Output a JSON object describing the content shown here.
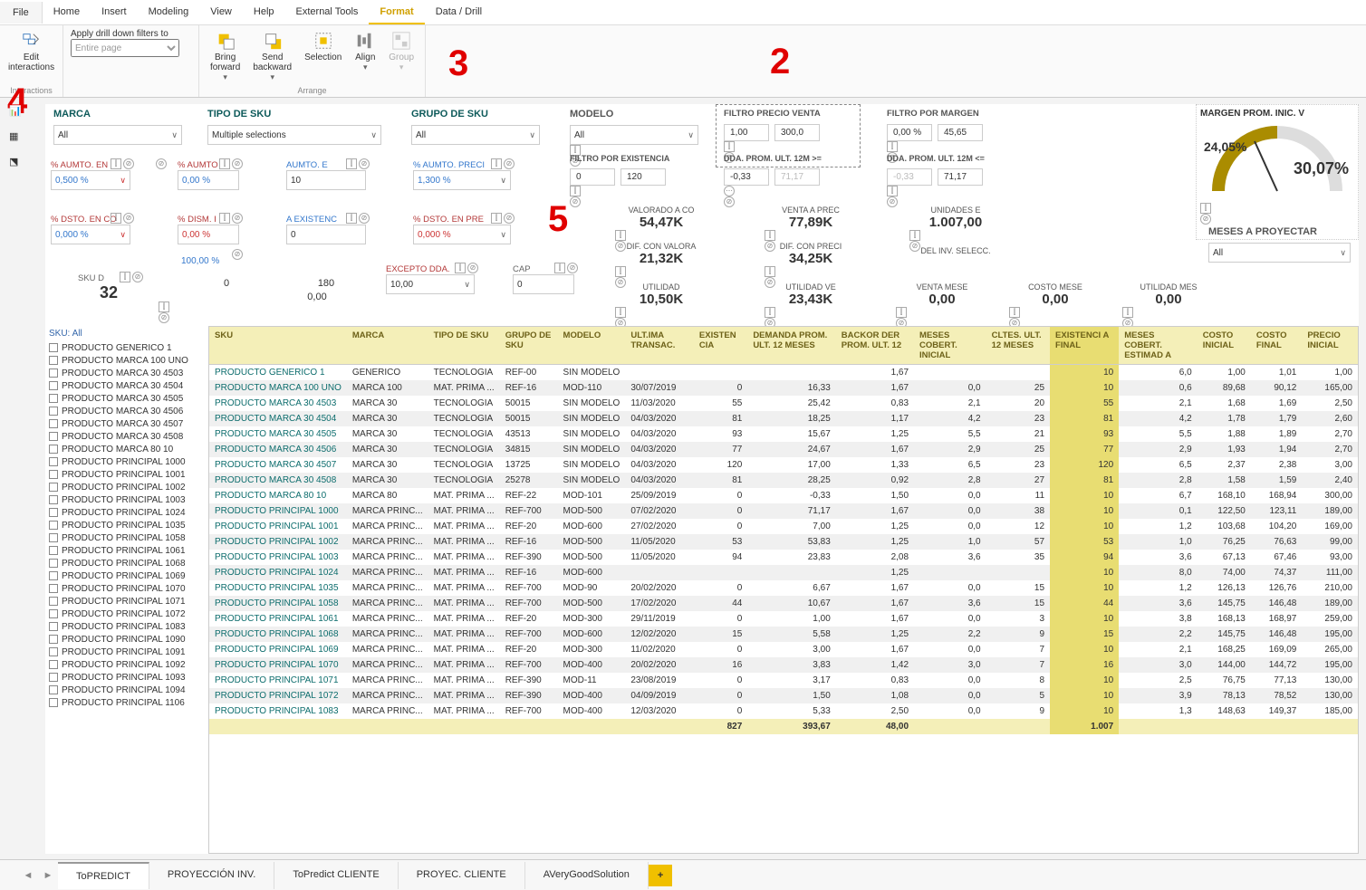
{
  "menu": {
    "file": "File",
    "items": [
      "Home",
      "Insert",
      "Modeling",
      "View",
      "Help",
      "External Tools",
      "Format",
      "Data / Drill"
    ],
    "active": 6
  },
  "ribbon": {
    "editInteractions": "Edit\ninteractions",
    "interactionsGroup": "Interactions",
    "drillLabel": "Apply drill down filters to",
    "drillPlaceholder": "Entire page",
    "bring": "Bring\nforward",
    "send": "Send\nbackward",
    "selection": "Selection",
    "align": "Align",
    "group": "Group",
    "arrangeGroup": "Arrange"
  },
  "annotations": {
    "a2": "2",
    "a3": "3",
    "a4": "4",
    "a5": "5"
  },
  "slicers": {
    "marca": {
      "title": "MARCA",
      "value": "All"
    },
    "tiposku": {
      "title": "TIPO DE SKU",
      "value": "Multiple selections"
    },
    "gruposku": {
      "title": "GRUPO DE SKU",
      "value": "All"
    },
    "modelo": {
      "title": "MODELO",
      "value": "All"
    }
  },
  "filters": {
    "precioVenta": {
      "title": "FILTRO PRECIO VENTA",
      "from": "1,00",
      "to": "300,0"
    },
    "margen": {
      "title": "FILTRO POR MARGEN",
      "from": "0,00 %",
      "to": "45,65"
    },
    "existencias": {
      "title": "FILTRO POR EXISTENCIA",
      "from": "0",
      "to": "120"
    },
    "dda12a": {
      "title": "DDA. PROM. ULT. 12M >=",
      "from": "-0,33",
      "to": "71,17"
    },
    "dda12b": {
      "title": "DDA. PROM. ULT. 12M <=",
      "from": "-0,33",
      "to": "71,17"
    }
  },
  "params": {
    "aumtoEn": {
      "label": "% AUMTO. EN",
      "value": "0,500 %"
    },
    "aumto": {
      "label": "% AUMTO",
      "value": "0,00 %"
    },
    "aumtoE": {
      "label": "AUMTO. E",
      "value": "10"
    },
    "aumtoPreci": {
      "label": "% AUMTO. PRECI",
      "value": "1,300 %"
    },
    "dstoEnC": {
      "label": "% DSTO. EN CO",
      "value": "0,000 %"
    },
    "dismI": {
      "label": "% DISM. I",
      "value": "0,00 %"
    },
    "aExisten": {
      "label": "A EXISTENC",
      "value": "0"
    },
    "dstoEnPre": {
      "label": "% DSTO. EN PRE",
      "value": "0,000 %"
    },
    "n100": {
      "label": "",
      "value": "100,00 %"
    },
    "n0": {
      "value": "0"
    },
    "n180": {
      "value": "180"
    },
    "exceptoDda": {
      "label": "EXCEPTO DDA.",
      "value": "10,00"
    },
    "cap": {
      "label": "CAP",
      "value": "0"
    },
    "skuD": {
      "label": "SKU D",
      "value": "32"
    },
    "z000": {
      "value": "0,00"
    }
  },
  "kpis": {
    "valoradoCosto": {
      "label": "VALORADO A CO",
      "value": "54,47K"
    },
    "ventaPrecio": {
      "label": "VENTA A PREC",
      "value": "77,89K"
    },
    "unidadesE": {
      "label": "UNIDADES E",
      "value": "1.007,00"
    },
    "difValor": {
      "label": "DIF. CON VALORA",
      "value": "21,32K"
    },
    "difPrecio": {
      "label": "DIF. CON PRECI",
      "value": "34,25K"
    },
    "delInv": {
      "label": "DEL INV. SELECC.",
      "value": ""
    },
    "utilidad": {
      "label": "UTILIDAD",
      "value": "10,50K"
    },
    "utilidadVe": {
      "label": "UTILIDAD VE",
      "value": "23,43K"
    },
    "ventaMese": {
      "label": "VENTA MESE",
      "value": "0,00"
    },
    "costoMese": {
      "label": "COSTO MESE",
      "value": "0,00"
    },
    "utilidadMes": {
      "label": "UTILIDAD MES",
      "value": "0,00"
    }
  },
  "gauge": {
    "title": "MARGEN PROM. INIC. V",
    "start": "24,05%",
    "end": "30,07%"
  },
  "meses": {
    "title": "MESES A PROYECTAR",
    "value": "All"
  },
  "skuAll": "SKU: All",
  "skuItems": [
    "PRODUCTO GENERICO 1",
    "PRODUCTO MARCA 100 UNO",
    "PRODUCTO MARCA 30 4503",
    "PRODUCTO MARCA 30 4504",
    "PRODUCTO MARCA 30 4505",
    "PRODUCTO MARCA 30 4506",
    "PRODUCTO MARCA 30 4507",
    "PRODUCTO MARCA 30 4508",
    "PRODUCTO MARCA 80 10",
    "PRODUCTO PRINCIPAL 1000",
    "PRODUCTO PRINCIPAL 1001",
    "PRODUCTO PRINCIPAL 1002",
    "PRODUCTO PRINCIPAL 1003",
    "PRODUCTO PRINCIPAL 1024",
    "PRODUCTO PRINCIPAL 1035",
    "PRODUCTO PRINCIPAL 1058",
    "PRODUCTO PRINCIPAL 1061",
    "PRODUCTO PRINCIPAL 1068",
    "PRODUCTO PRINCIPAL 1069",
    "PRODUCTO PRINCIPAL 1070",
    "PRODUCTO PRINCIPAL 1071",
    "PRODUCTO PRINCIPAL 1072",
    "PRODUCTO PRINCIPAL 1083",
    "PRODUCTO PRINCIPAL 1090",
    "PRODUCTO PRINCIPAL 1091",
    "PRODUCTO PRINCIPAL 1092",
    "PRODUCTO PRINCIPAL 1093",
    "PRODUCTO PRINCIPAL 1094",
    "PRODUCTO PRINCIPAL 1106"
  ],
  "table": {
    "headers": [
      "SKU",
      "MARCA",
      "TIPO DE SKU",
      "GRUPO DE SKU",
      "MODELO",
      "ULT.IMA TRANSAC.",
      "EXISTEN CIA",
      "DEMANDA PROM. ULT. 12 MESES",
      "BACKOR DER PROM. ULT. 12",
      "MESES COBERT. INICIAL",
      "CLTES. ULT. 12 MESES",
      "EXISTENCI A FINAL",
      "MESES COBERT. ESTIMAD A",
      "COSTO INICIAL",
      "COSTO FINAL",
      "PRECIO INICIAL"
    ],
    "rows": [
      [
        "PRODUCTO GENERICO 1",
        "GENERICO",
        "TECNOLOGIA",
        "REF-00",
        "SIN MODELO",
        "",
        "",
        "",
        "1,67",
        "",
        "",
        "10",
        "6,0",
        "1,00",
        "1,01",
        "1,00"
      ],
      [
        "PRODUCTO MARCA 100 UNO",
        "MARCA 100",
        "MAT. PRIMA ...",
        "REF-16",
        "MOD-110",
        "30/07/2019",
        "0",
        "16,33",
        "1,67",
        "0,0",
        "25",
        "10",
        "0,6",
        "89,68",
        "90,12",
        "165,00"
      ],
      [
        "PRODUCTO MARCA 30 4503",
        "MARCA 30",
        "TECNOLOGIA",
        "50015",
        "SIN MODELO",
        "11/03/2020",
        "55",
        "25,42",
        "0,83",
        "2,1",
        "20",
        "55",
        "2,1",
        "1,68",
        "1,69",
        "2,50"
      ],
      [
        "PRODUCTO MARCA 30 4504",
        "MARCA 30",
        "TECNOLOGIA",
        "50015",
        "SIN MODELO",
        "04/03/2020",
        "81",
        "18,25",
        "1,17",
        "4,2",
        "23",
        "81",
        "4,2",
        "1,78",
        "1,79",
        "2,60"
      ],
      [
        "PRODUCTO MARCA 30 4505",
        "MARCA 30",
        "TECNOLOGIA",
        "43513",
        "SIN MODELO",
        "04/03/2020",
        "93",
        "15,67",
        "1,25",
        "5,5",
        "21",
        "93",
        "5,5",
        "1,88",
        "1,89",
        "2,70"
      ],
      [
        "PRODUCTO MARCA 30 4506",
        "MARCA 30",
        "TECNOLOGIA",
        "34815",
        "SIN MODELO",
        "04/03/2020",
        "77",
        "24,67",
        "1,67",
        "2,9",
        "25",
        "77",
        "2,9",
        "1,93",
        "1,94",
        "2,70"
      ],
      [
        "PRODUCTO MARCA 30 4507",
        "MARCA 30",
        "TECNOLOGIA",
        "13725",
        "SIN MODELO",
        "04/03/2020",
        "120",
        "17,00",
        "1,33",
        "6,5",
        "23",
        "120",
        "6,5",
        "2,37",
        "2,38",
        "3,00"
      ],
      [
        "PRODUCTO MARCA 30 4508",
        "MARCA 30",
        "TECNOLOGIA",
        "25278",
        "SIN MODELO",
        "04/03/2020",
        "81",
        "28,25",
        "0,92",
        "2,8",
        "27",
        "81",
        "2,8",
        "1,58",
        "1,59",
        "2,40"
      ],
      [
        "PRODUCTO MARCA 80 10",
        "MARCA 80",
        "MAT. PRIMA ...",
        "REF-22",
        "MOD-101",
        "25/09/2019",
        "0",
        "-0,33",
        "1,50",
        "0,0",
        "11",
        "10",
        "6,7",
        "168,10",
        "168,94",
        "300,00"
      ],
      [
        "PRODUCTO PRINCIPAL 1000",
        "MARCA PRINC...",
        "MAT. PRIMA ...",
        "REF-700",
        "MOD-500",
        "07/02/2020",
        "0",
        "71,17",
        "1,67",
        "0,0",
        "38",
        "10",
        "0,1",
        "122,50",
        "123,11",
        "189,00"
      ],
      [
        "PRODUCTO PRINCIPAL 1001",
        "MARCA PRINC...",
        "MAT. PRIMA ...",
        "REF-20",
        "MOD-600",
        "27/02/2020",
        "0",
        "7,00",
        "1,25",
        "0,0",
        "12",
        "10",
        "1,2",
        "103,68",
        "104,20",
        "169,00"
      ],
      [
        "PRODUCTO PRINCIPAL 1002",
        "MARCA PRINC...",
        "MAT. PRIMA ...",
        "REF-16",
        "MOD-500",
        "11/05/2020",
        "53",
        "53,83",
        "1,25",
        "1,0",
        "57",
        "53",
        "1,0",
        "76,25",
        "76,63",
        "99,00"
      ],
      [
        "PRODUCTO PRINCIPAL 1003",
        "MARCA PRINC...",
        "MAT. PRIMA ...",
        "REF-390",
        "MOD-500",
        "11/05/2020",
        "94",
        "23,83",
        "2,08",
        "3,6",
        "35",
        "94",
        "3,6",
        "67,13",
        "67,46",
        "93,00"
      ],
      [
        "PRODUCTO PRINCIPAL 1024",
        "MARCA PRINC...",
        "MAT. PRIMA ...",
        "REF-16",
        "MOD-600",
        "",
        "",
        "",
        "1,25",
        "",
        "",
        "10",
        "8,0",
        "74,00",
        "74,37",
        "111,00"
      ],
      [
        "PRODUCTO PRINCIPAL 1035",
        "MARCA PRINC...",
        "MAT. PRIMA ...",
        "REF-700",
        "MOD-90",
        "20/02/2020",
        "0",
        "6,67",
        "1,67",
        "0,0",
        "15",
        "10",
        "1,2",
        "126,13",
        "126,76",
        "210,00"
      ],
      [
        "PRODUCTO PRINCIPAL 1058",
        "MARCA PRINC...",
        "MAT. PRIMA ...",
        "REF-700",
        "MOD-500",
        "17/02/2020",
        "44",
        "10,67",
        "1,67",
        "3,6",
        "15",
        "44",
        "3,6",
        "145,75",
        "146,48",
        "189,00"
      ],
      [
        "PRODUCTO PRINCIPAL 1061",
        "MARCA PRINC...",
        "MAT. PRIMA ...",
        "REF-20",
        "MOD-300",
        "29/11/2019",
        "0",
        "1,00",
        "1,67",
        "0,0",
        "3",
        "10",
        "3,8",
        "168,13",
        "168,97",
        "259,00"
      ],
      [
        "PRODUCTO PRINCIPAL 1068",
        "MARCA PRINC...",
        "MAT. PRIMA ...",
        "REF-700",
        "MOD-600",
        "12/02/2020",
        "15",
        "5,58",
        "1,25",
        "2,2",
        "9",
        "15",
        "2,2",
        "145,75",
        "146,48",
        "195,00"
      ],
      [
        "PRODUCTO PRINCIPAL 1069",
        "MARCA PRINC...",
        "MAT. PRIMA ...",
        "REF-20",
        "MOD-300",
        "11/02/2020",
        "0",
        "3,00",
        "1,67",
        "0,0",
        "7",
        "10",
        "2,1",
        "168,25",
        "169,09",
        "265,00"
      ],
      [
        "PRODUCTO PRINCIPAL 1070",
        "MARCA PRINC...",
        "MAT. PRIMA ...",
        "REF-700",
        "MOD-400",
        "20/02/2020",
        "16",
        "3,83",
        "1,42",
        "3,0",
        "7",
        "16",
        "3,0",
        "144,00",
        "144,72",
        "195,00"
      ],
      [
        "PRODUCTO PRINCIPAL 1071",
        "MARCA PRINC...",
        "MAT. PRIMA ...",
        "REF-390",
        "MOD-11",
        "23/08/2019",
        "0",
        "3,17",
        "0,83",
        "0,0",
        "8",
        "10",
        "2,5",
        "76,75",
        "77,13",
        "130,00"
      ],
      [
        "PRODUCTO PRINCIPAL 1072",
        "MARCA PRINC...",
        "MAT. PRIMA ...",
        "REF-390",
        "MOD-400",
        "04/09/2019",
        "0",
        "1,50",
        "1,08",
        "0,0",
        "5",
        "10",
        "3,9",
        "78,13",
        "78,52",
        "130,00"
      ],
      [
        "PRODUCTO PRINCIPAL 1083",
        "MARCA PRINC...",
        "MAT. PRIMA ...",
        "REF-700",
        "MOD-400",
        "12/03/2020",
        "0",
        "5,33",
        "2,50",
        "0,0",
        "9",
        "10",
        "1,3",
        "148,63",
        "149,37",
        "185,00"
      ]
    ],
    "footer": [
      "",
      "",
      "",
      "",
      "",
      "",
      "827",
      "393,67",
      "48,00",
      "",
      "",
      "1.007",
      "",
      "",
      "",
      ""
    ]
  },
  "tabs": {
    "items": [
      "ToPREDICT",
      "PROYECCIÓN INV.",
      "ToPredict CLIENTE",
      "PROYEC. CLIENTE",
      "AVeryGoodSolution"
    ],
    "active": 0,
    "add": "+"
  }
}
